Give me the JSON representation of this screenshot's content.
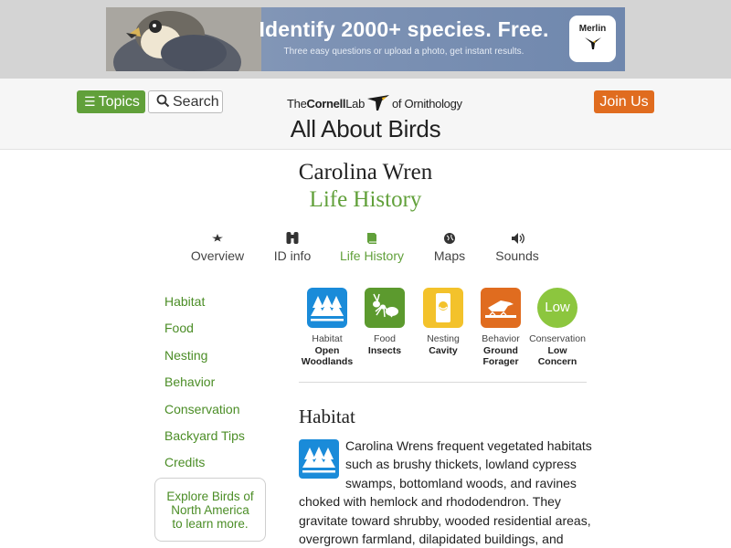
{
  "ad": {
    "title": "Identify 2000+ species. Free.",
    "subtitle": "Three easy questions or upload a photo, get instant results.",
    "logo_text": "Merlin"
  },
  "header": {
    "topics_label": "Topics",
    "search_label": "Search",
    "logo_the": "The",
    "logo_cornell": "Cornell",
    "logo_lab": "Lab",
    "logo_of": "of Ornithology",
    "site_title": "All About Birds",
    "join_label": "Join Us"
  },
  "page": {
    "species": "Carolina Wren",
    "section": "Life History"
  },
  "tabs": [
    {
      "label": "Overview",
      "icon": "star-icon"
    },
    {
      "label": "ID info",
      "icon": "binoculars-icon"
    },
    {
      "label": "Life History",
      "icon": "book-icon",
      "active": true
    },
    {
      "label": "Maps",
      "icon": "globe-icon"
    },
    {
      "label": "Sounds",
      "icon": "speaker-icon"
    }
  ],
  "sidebar": {
    "items": [
      {
        "label": "Habitat"
      },
      {
        "label": "Food"
      },
      {
        "label": "Nesting"
      },
      {
        "label": "Behavior"
      },
      {
        "label": "Conservation"
      },
      {
        "label": "Backyard Tips"
      },
      {
        "label": "Credits"
      }
    ],
    "explore_lines": [
      "Explore Birds of",
      "North America",
      "to learn more."
    ]
  },
  "tiles": [
    {
      "category": "Habitat",
      "value_lines": [
        "Open",
        "Woodlands"
      ],
      "color": "#1a8bd9",
      "icon": "trees-icon"
    },
    {
      "category": "Food",
      "value_lines": [
        "Insects"
      ],
      "color": "#5c9a2e",
      "icon": "ant-icon"
    },
    {
      "category": "Nesting",
      "value_lines": [
        "Cavity"
      ],
      "color": "#f3c22b",
      "icon": "cavity-nest-icon"
    },
    {
      "category": "Behavior",
      "value_lines": [
        "Ground",
        "Forager"
      ],
      "color": "#e06c1f",
      "icon": "ground-forager-icon"
    },
    {
      "category": "Conservation",
      "value_lines": [
        "Low",
        "Concern"
      ],
      "badge": "Low",
      "color": "#8cc63e",
      "icon": "low-concern-badge"
    }
  ],
  "habitat": {
    "heading": "Habitat",
    "lines": [
      "Carolina Wrens frequent vegetated habitats",
      "such as brushy thickets, lowland cypress",
      "swamps, bottomland woods, and ravines",
      "choked with hemlock and rhododendron. They",
      "gravitate toward shrubby, wooded residential areas,",
      "overgrown farmland, dilapidated buildings, and brushy"
    ]
  }
}
